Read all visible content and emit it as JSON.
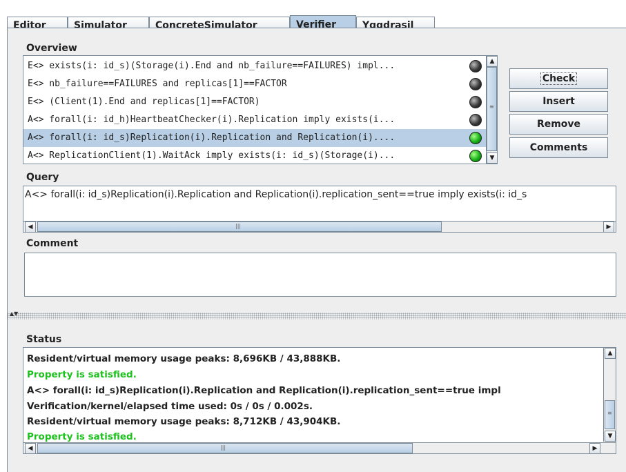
{
  "tabs": [
    {
      "label": "Editor"
    },
    {
      "label": "Simulator"
    },
    {
      "label": "ConcreteSimulator"
    },
    {
      "label": "Verifier",
      "active": true
    },
    {
      "label": "Yggdrasil"
    }
  ],
  "overview": {
    "label": "Overview",
    "queries": [
      {
        "text": "E<> exists(i: id_s)(Storage(i).End and nb_failure==FAILURES) impl...",
        "status": "grey",
        "selected": false
      },
      {
        "text": "E<> nb_failure==FAILURES and replicas[1]==FACTOR",
        "status": "grey",
        "selected": false
      },
      {
        "text": "E<> (Client(1).End and replicas[1]==FACTOR)",
        "status": "grey",
        "selected": false
      },
      {
        "text": "A<> forall(i: id_h)HeartbeatChecker(i).Replication imply exists(i...",
        "status": "grey",
        "selected": false
      },
      {
        "text": "A<> forall(i: id_s)Replication(i).Replication and Replication(i)....",
        "status": "green",
        "selected": true
      },
      {
        "text": "A<> ReplicationClient(1).WaitAck imply exists(i: id_s)(Storage(i)...",
        "status": "green",
        "selected": false
      }
    ]
  },
  "buttons": {
    "check": "Check",
    "insert": "Insert",
    "remove": "Remove",
    "comments": "Comments"
  },
  "query": {
    "label": "Query",
    "value": "A<> forall(i: id_s)Replication(i).Replication and Replication(i).replication_sent==true  imply exists(i: id_s"
  },
  "comment": {
    "label": "Comment",
    "value": ""
  },
  "status": {
    "label": "Status",
    "lines": [
      {
        "text": "Resident/virtual memory usage peaks: 8,696KB / 43,888KB.",
        "color": "black"
      },
      {
        "text": "Property is satisfied.",
        "color": "green"
      },
      {
        "text": "A<> forall(i: id_s)Replication(i).Replication and Replication(i).replication_sent==true  impl",
        "color": "black"
      },
      {
        "text": "Verification/kernel/elapsed time used: 0s / 0s / 0.002s.",
        "color": "black"
      },
      {
        "text": "Resident/virtual memory usage peaks: 8,712KB / 43,904KB.",
        "color": "black"
      },
      {
        "text": "Property is satisfied.",
        "color": "green"
      }
    ]
  },
  "colors": {
    "selection": "#b8cfe5",
    "satisfied_green": "#1ec01e",
    "border": "#7a8a99",
    "panel_bg": "#eeeeee"
  }
}
